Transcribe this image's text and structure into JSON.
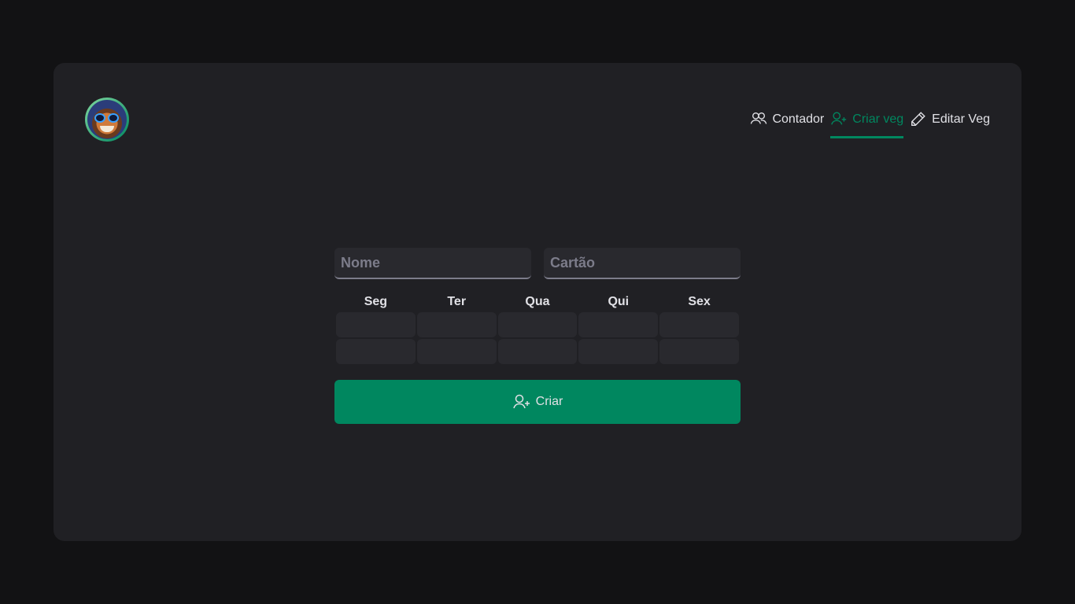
{
  "header": {
    "avatar": "avatar-image",
    "nav": [
      {
        "label": "Contador",
        "icon": "users-icon",
        "active": false
      },
      {
        "label": "Criar veg",
        "icon": "user-plus-icon",
        "active": true
      },
      {
        "label": "Editar Veg",
        "icon": "pencil-icon",
        "active": false
      }
    ]
  },
  "form": {
    "nome_placeholder": "Nome",
    "cartao_placeholder": "Cartão",
    "days": [
      "Seg",
      "Ter",
      "Qua",
      "Qui",
      "Sex"
    ],
    "submit_label": "Criar",
    "submit_icon": "user-plus-icon"
  },
  "colors": {
    "accent": "#00875f",
    "background": "#121214",
    "card": "#202024",
    "input": "#29292e",
    "text": "#e1e1e6",
    "placeholder": "#7c7c8a"
  }
}
